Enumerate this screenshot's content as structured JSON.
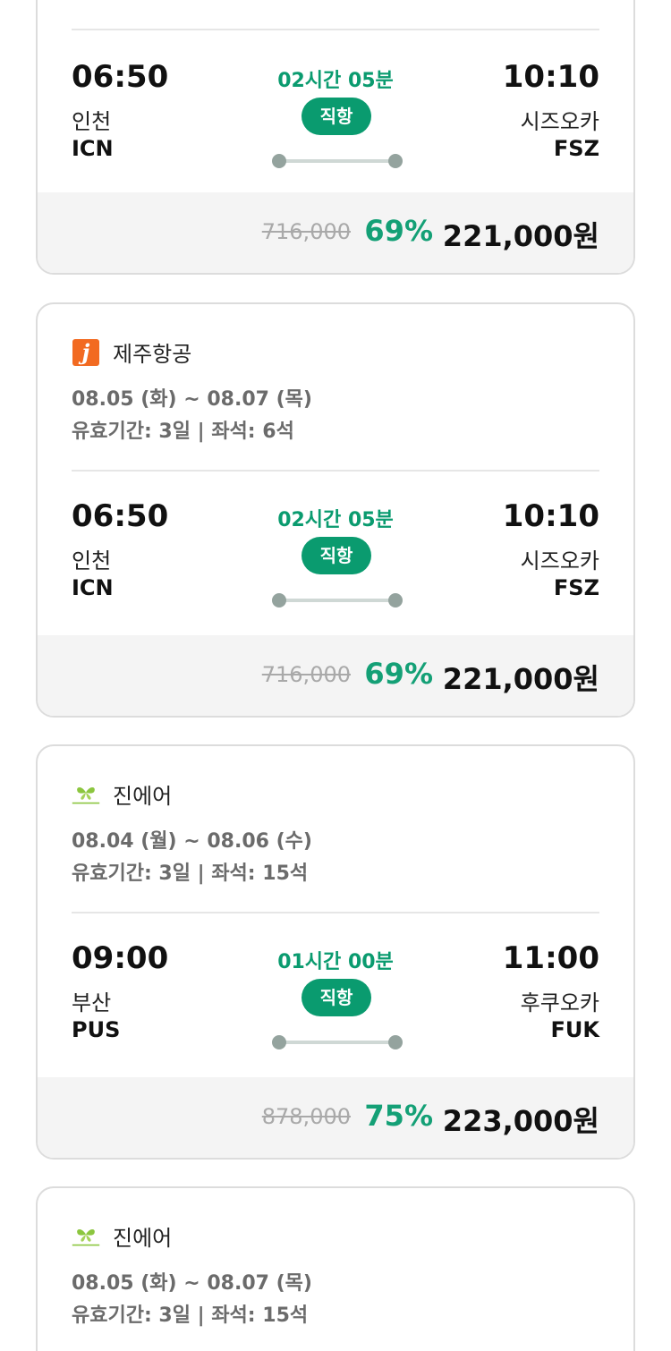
{
  "cards": [
    {
      "flight": {
        "dep_time": "06:50",
        "dep_city": "인천",
        "dep_code": "ICN",
        "duration": "02시간 05분",
        "badge": "직항",
        "arr_time": "10:10",
        "arr_city": "시즈오카",
        "arr_code": "FSZ"
      },
      "price": {
        "original": "716,000",
        "discount": "69%",
        "final": "221,000원"
      }
    },
    {
      "airline": {
        "name": "제주항공",
        "logo": "jeju-air-logo",
        "logo_letter": "j",
        "logo_color": "#f26a21"
      },
      "dates": "08.05 (화) ~ 08.07 (목)",
      "validity": "유효기간: 3일 | 좌석: 6석",
      "flight": {
        "dep_time": "06:50",
        "dep_city": "인천",
        "dep_code": "ICN",
        "duration": "02시간 05분",
        "badge": "직항",
        "arr_time": "10:10",
        "arr_city": "시즈오카",
        "arr_code": "FSZ"
      },
      "price": {
        "original": "716,000",
        "discount": "69%",
        "final": "221,000원"
      }
    },
    {
      "airline": {
        "name": "진에어",
        "logo": "jin-air-logo",
        "logo_color": "#8cc63f"
      },
      "dates": "08.04 (월) ~ 08.06 (수)",
      "validity": "유효기간: 3일 | 좌석: 15석",
      "flight": {
        "dep_time": "09:00",
        "dep_city": "부산",
        "dep_code": "PUS",
        "duration": "01시간 00분",
        "badge": "직항",
        "arr_time": "11:00",
        "arr_city": "후쿠오카",
        "arr_code": "FUK"
      },
      "price": {
        "original": "878,000",
        "discount": "75%",
        "final": "223,000원"
      }
    },
    {
      "airline": {
        "name": "진에어",
        "logo": "jin-air-logo",
        "logo_color": "#8cc63f"
      },
      "dates": "08.05 (화) ~ 08.07 (목)",
      "validity": "유효기간: 3일 | 좌석: 15석"
    }
  ],
  "colors": {
    "accent": "#0a9b6f",
    "discount": "#14a076",
    "price_bg": "#f4f4f4"
  }
}
